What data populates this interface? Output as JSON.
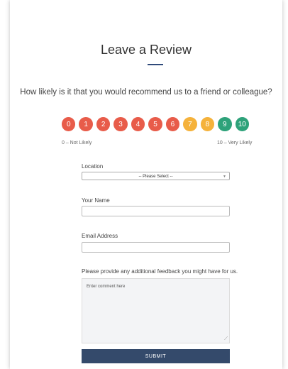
{
  "form": {
    "title": "Leave a Review",
    "question": "How likely is it that you would recommend us to a friend or colleague?",
    "scale": {
      "labels": [
        "0",
        "1",
        "2",
        "3",
        "4",
        "5",
        "6",
        "7",
        "8",
        "9",
        "10"
      ],
      "colors": [
        "#e85c4a",
        "#e85c4a",
        "#e85c4a",
        "#e85c4a",
        "#e85c4a",
        "#e85c4a",
        "#e85c4a",
        "#f5b23b",
        "#f5b23b",
        "#2ea27a",
        "#2ea27a"
      ],
      "left_label": "0 – Not Likely",
      "right_label": "10 – Very Likely"
    },
    "location": {
      "label": "Location",
      "selected": "-- Please Select --"
    },
    "name": {
      "label": "Your Name",
      "value": ""
    },
    "email": {
      "label": "Email Address",
      "value": ""
    },
    "feedback": {
      "label": "Please provide any additional feedback you might have for us.",
      "placeholder": "Enter comment here"
    },
    "submit_label": "SUBMIT"
  }
}
